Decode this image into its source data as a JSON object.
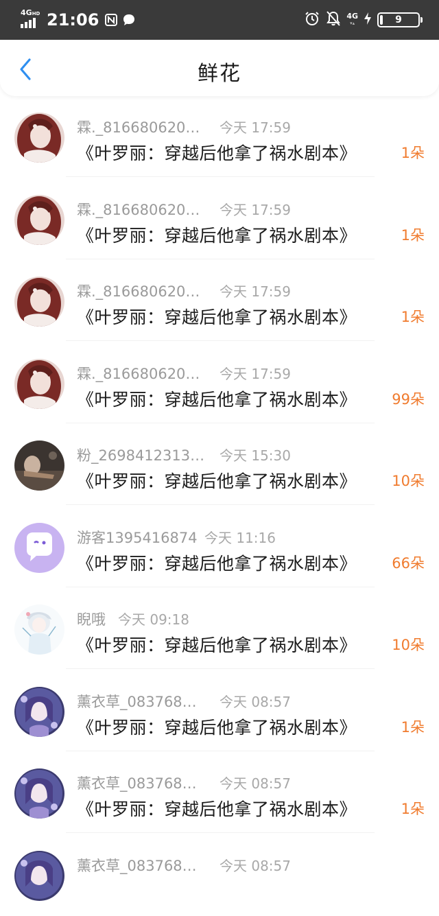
{
  "status_bar": {
    "network": "4G",
    "network_sub": "HD",
    "time": "21:06",
    "net_right": "4G",
    "battery": "9",
    "icons": [
      "signal-icon",
      "nfc-icon",
      "message-bubble-icon",
      "alarm-icon",
      "mute-bell-icon",
      "charging-icon",
      "battery-icon"
    ]
  },
  "nav": {
    "title": "鲜花",
    "back_icon": "chevron-left-icon",
    "accent": "#2f8ff0"
  },
  "colors": {
    "count": "#f07b2e",
    "meta": "#9a9a9a",
    "text": "#1c1c1c"
  },
  "records": [
    {
      "name": "霖._816680620…",
      "time": "今天 17:59",
      "book": "《叶罗丽：穿越后他拿了祸水剧本》",
      "count": "1朵",
      "avatar": "anime-girl-red-hair"
    },
    {
      "name": "霖._816680620…",
      "time": "今天 17:59",
      "book": "《叶罗丽：穿越后他拿了祸水剧本》",
      "count": "1朵",
      "avatar": "anime-girl-red-hair"
    },
    {
      "name": "霖._816680620…",
      "time": "今天 17:59",
      "book": "《叶罗丽：穿越后他拿了祸水剧本》",
      "count": "1朵",
      "avatar": "anime-girl-red-hair"
    },
    {
      "name": "霖._816680620…",
      "time": "今天 17:59",
      "book": "《叶罗丽：穿越后他拿了祸水剧本》",
      "count": "99朵",
      "avatar": "anime-girl-red-hair"
    },
    {
      "name": "粉_2698412313…",
      "time": "今天 15:30",
      "book": "《叶罗丽：穿越后他拿了祸水剧本》",
      "count": "10朵",
      "avatar": "dark-photo"
    },
    {
      "name": "游客1395416874",
      "time": "今天 11:16",
      "book": "《叶罗丽：穿越后他拿了祸水剧本》",
      "count": "66朵",
      "avatar": "chat-bubble-default"
    },
    {
      "name": "睨哦",
      "time": "今天 09:18",
      "book": "《叶罗丽：穿越后他拿了祸水剧本》",
      "count": "10朵",
      "avatar": "anime-white-hair"
    },
    {
      "name": "薰衣草_083768…",
      "time": "今天 08:57",
      "book": "《叶罗丽：穿越后他拿了祸水剧本》",
      "count": "1朵",
      "avatar": "anime-purple"
    },
    {
      "name": "薰衣草_083768…",
      "time": "今天 08:57",
      "book": "《叶罗丽：穿越后他拿了祸水剧本》",
      "count": "1朵",
      "avatar": "anime-purple"
    },
    {
      "name": "薰衣草_083768…",
      "time": "今天 08:57",
      "book": "",
      "count": "",
      "avatar": "anime-purple"
    }
  ]
}
